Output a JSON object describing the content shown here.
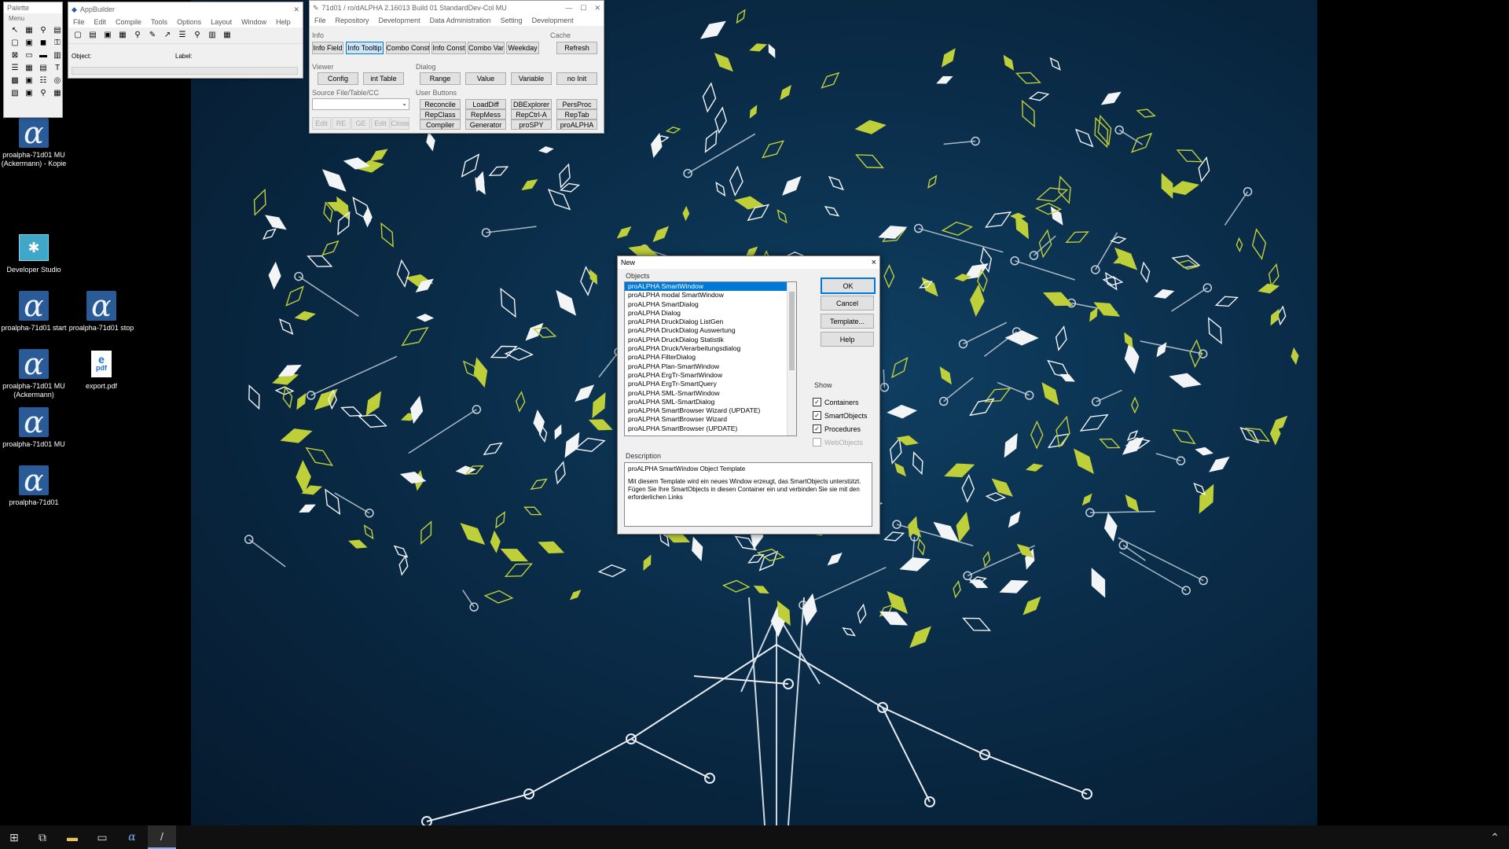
{
  "desktop": {
    "icons": [
      {
        "label": "proalpha-71d01 MU (Ackermann) - Kopie"
      },
      {
        "label": "Developer Studio"
      },
      {
        "label": "proalpha-71d01 start"
      },
      {
        "label": "proalpha-71d01 stop"
      },
      {
        "label": "proalpha-71d01 MU (Ackermann)"
      },
      {
        "label": "export.pdf"
      },
      {
        "label": "proalpha-71d01 MU"
      },
      {
        "label": "proalpha-71d01"
      }
    ],
    "pdf_badge": "pdf",
    "alpha_glyph": "α"
  },
  "palette": {
    "title": "Palette",
    "menu_label": "Menu"
  },
  "appbuilder": {
    "title": "AppBuilder",
    "menus": [
      "File",
      "Edit",
      "Compile",
      "Tools",
      "Options",
      "Layout",
      "Window",
      "Help"
    ],
    "object_label": "Object:",
    "label_label": "Label:"
  },
  "protools": {
    "title": "71d01 / ro/dALPHA 2.16013 Build 01 StandardDev-Col MU",
    "menus": [
      "File",
      "Repository",
      "Development",
      "Data Administration",
      "Setting",
      "Development"
    ],
    "info_label": "Info",
    "cache_label": "Cache",
    "viewer_label": "Viewer",
    "dialog_label": "Dialog",
    "source_label": "Source File/Table/CC",
    "userbuttons_label": "User Buttons",
    "info_buttons": [
      "Info Field",
      "Info Tooltip",
      "Combo Const",
      "Info Const",
      "Combo Var",
      "Weekday"
    ],
    "refresh": "Refresh",
    "viewer_buttons": [
      "Config",
      "int Table"
    ],
    "dialog_buttons": [
      "Range",
      "Value",
      "Variable",
      "no Init"
    ],
    "source_buttons": [
      "Edit",
      "RE",
      "GE",
      "Edit",
      "Close"
    ],
    "user_buttons": [
      [
        "Reconcile",
        "LoadDiff",
        "DBExplorer",
        "PersProc"
      ],
      [
        "RepClass",
        "RepMess",
        "RepCtrl-A",
        "RepTab"
      ],
      [
        "Compiler",
        "Generator",
        "proSPY",
        "proALPHA"
      ]
    ]
  },
  "dialog": {
    "title": "New",
    "objects_label": "Objects",
    "objects": [
      "proALPHA SmartWindow",
      "proALPHA modal SmartWindow",
      "proALPHA SmartDialog",
      "proALPHA Dialog",
      "proALPHA DruckDialog ListGen",
      "proALPHA DruckDialog Auswertung",
      "proALPHA DruckDialog Statistik",
      "proALPHA Druck/Verarbeitungsdialog",
      "proALPHA FilterDialog",
      "proALPHA Plan-SmartWindow",
      "proALPHA ErgTr-SmartWindow",
      "proALPHA ErgTr-SmartQuery",
      "proALPHA SML-SmartWindow",
      "proALPHA SML-SmartDialog",
      "proALPHA SmartBrowser Wizard (UPDATE)",
      "proALPHA SmartBrowser Wizard",
      "proALPHA SmartBrowser (UPDATE)"
    ],
    "buttons": {
      "ok": "OK",
      "cancel": "Cancel",
      "template": "Template...",
      "help": "Help"
    },
    "show_label": "Show",
    "show_options": [
      {
        "label": "Containers",
        "checked": true
      },
      {
        "label": "SmartObjects",
        "checked": true
      },
      {
        "label": "Procedures",
        "checked": true
      },
      {
        "label": "WebObjects",
        "checked": false
      }
    ],
    "description_label": "Description",
    "description_title": "proALPHA SmartWindow Object Template",
    "description_text": "Mit diesem Template wird ein neues Window erzeugt, das SmartObjects unterstützt. Fügen Sie Ihre SmartObjects in diesen Container ein und verbinden Sie sie mit den erforderlichen Links",
    "close": "×"
  },
  "taskbar": {
    "items": [
      "start-icon",
      "task-view-icon",
      "file-explorer-icon",
      "window-icon",
      "proalpha-icon",
      "active-app-icon"
    ]
  }
}
